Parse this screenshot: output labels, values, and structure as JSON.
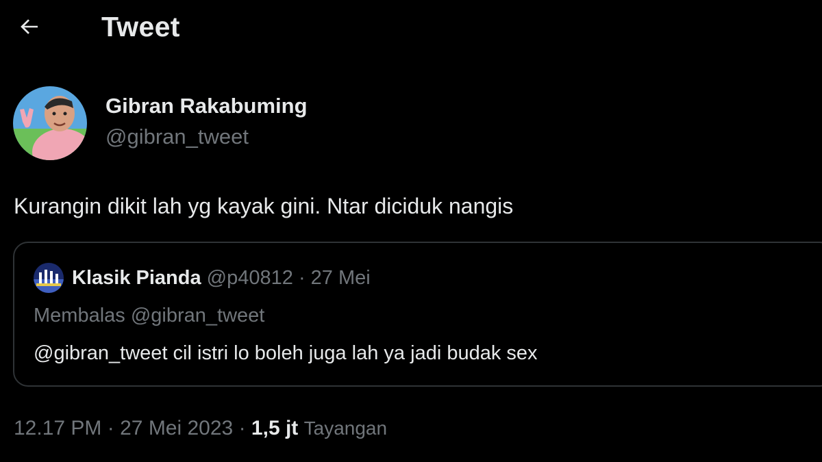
{
  "header": {
    "back_icon": "arrow-left-icon",
    "title": "Tweet"
  },
  "tweet": {
    "author": {
      "name": "Gibran Rakabuming",
      "handle": "@gibran_tweet"
    },
    "text": "Kurangin dikit lah yg kayak gini. Ntar diciduk nangis",
    "quote": {
      "author_name": "Klasik Pianda",
      "author_handle": "@p40812",
      "separator": "·",
      "date": "27 Mei",
      "reply_to": "Membalas @gibran_tweet",
      "text": "@gibran_tweet cil istri lo boleh juga lah ya jadi budak sex"
    },
    "meta": {
      "time": "12.17 PM",
      "separator": "·",
      "date": "27 Mei 2023",
      "views_count": "1,5 jt",
      "views_label": "Tayangan"
    }
  },
  "colors": {
    "background": "#000000",
    "text_primary": "#e7e9ea",
    "text_secondary": "#71767b",
    "border": "#2f3336"
  }
}
